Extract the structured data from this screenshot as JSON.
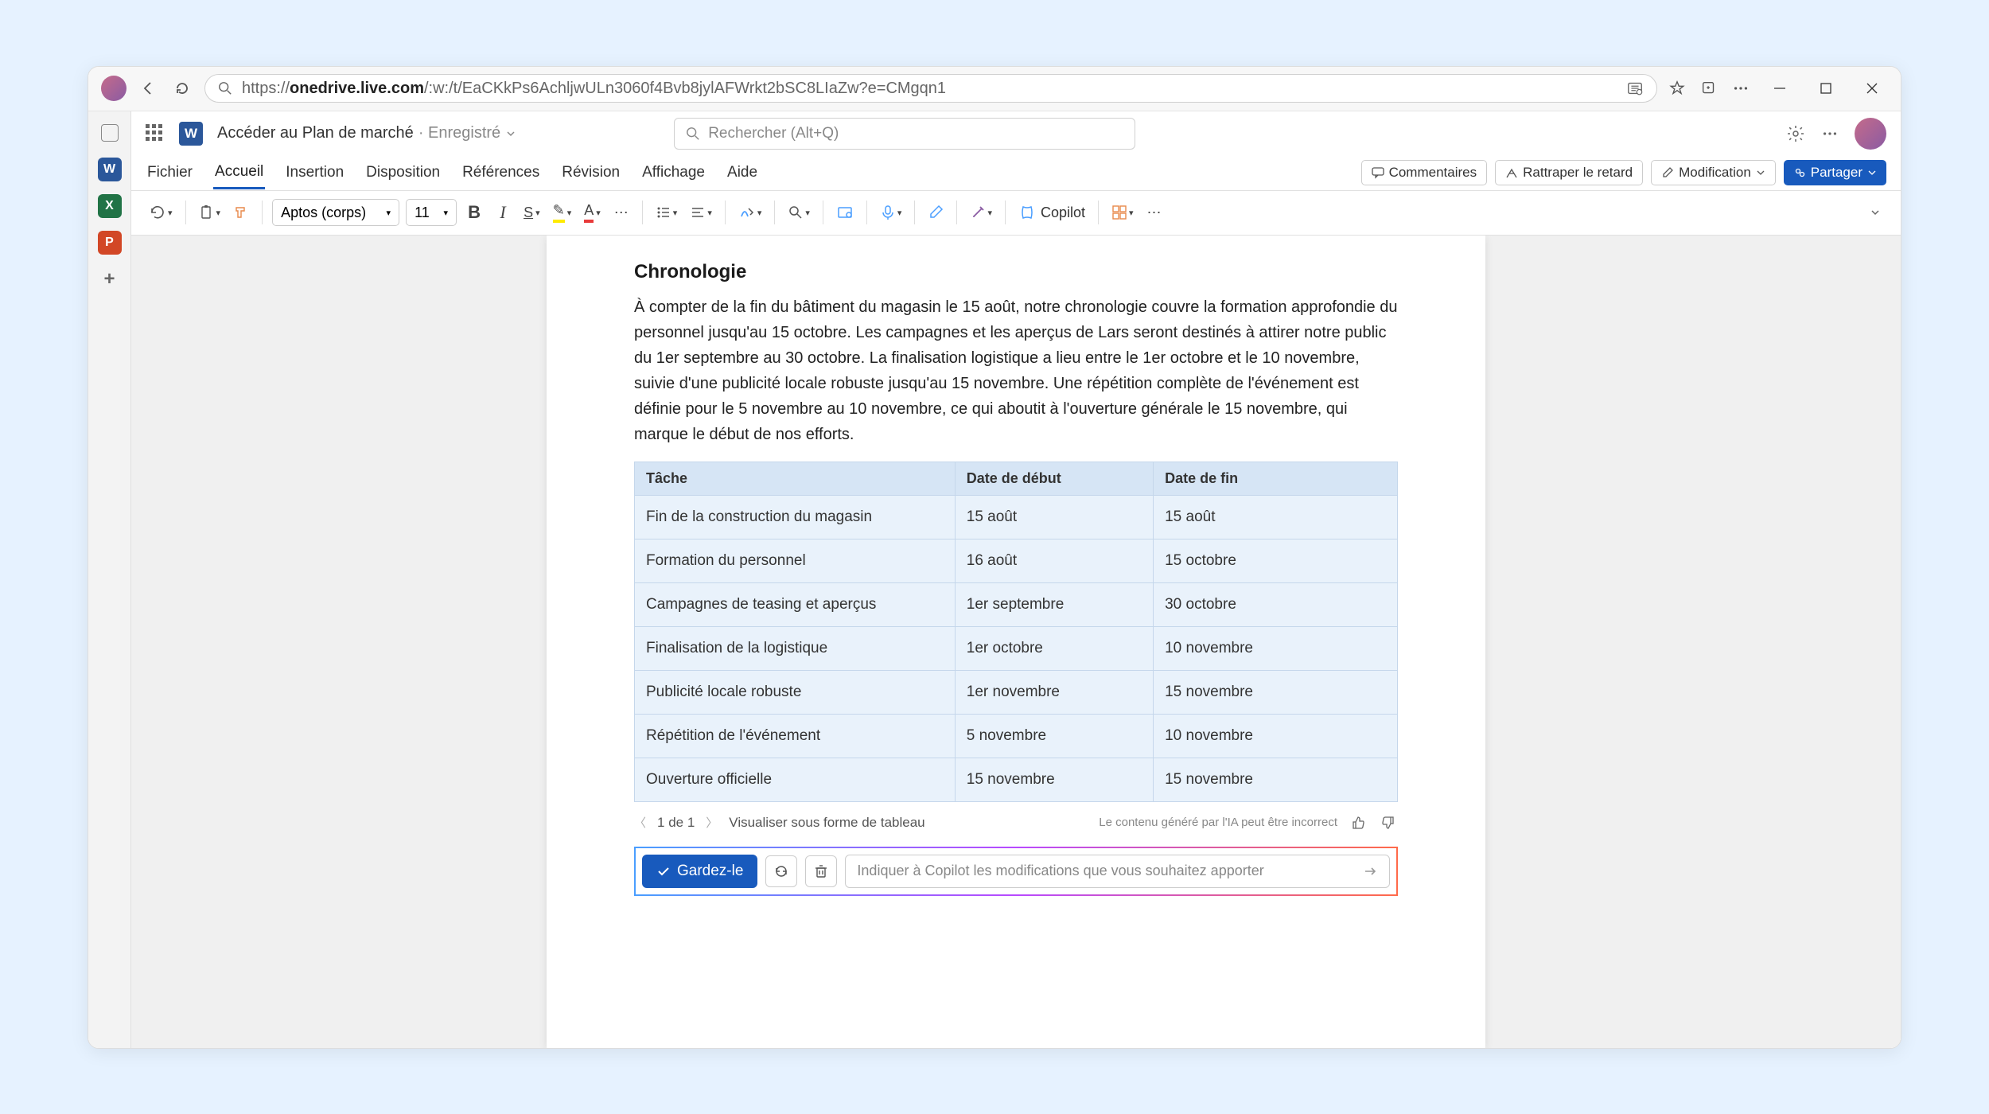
{
  "browser": {
    "url_prefix": "https://",
    "url_host": "onedrive.live.com",
    "url_path": "/:w:/t/EaCKkPs6AchljwULn3060f4Bvb8jylAFWrkt2bSC8LIaZw?e=CMgqn1"
  },
  "titlebar": {
    "doc_title": "Accéder au Plan de marché",
    "saved_status": "Enregistré",
    "search_placeholder": "Rechercher (Alt+Q)"
  },
  "menus": [
    "Fichier",
    "Accueil",
    "Insertion",
    "Disposition",
    "Références",
    "Révision",
    "Affichage",
    "Aide"
  ],
  "menu_active_index": 1,
  "menu_right": {
    "comments": "Commentaires",
    "catchup": "Rattraper le retard",
    "editing": "Modification",
    "share": "Partager"
  },
  "ribbon": {
    "font_name": "Aptos (corps)",
    "font_size": "11",
    "copilot": "Copilot"
  },
  "sidebar_apps": [
    "W",
    "X",
    "P"
  ],
  "document": {
    "heading": "Chronologie",
    "body": "À compter de la fin du bâtiment du magasin le 15 août, notre chronologie couvre la formation approfondie du personnel jusqu'au 15 octobre. Les campagnes et les aperçus de Lars seront destinés à attirer notre public du 1er septembre au 30 octobre. La finalisation logistique a lieu entre le 1er octobre et le 10 novembre, suivie d'une publicité locale robuste jusqu'au 15 novembre. Une répétition complète de l'événement est définie pour le 5 novembre au 10 novembre, ce qui aboutit à l'ouverture générale le 15 novembre, qui marque le début de nos efforts.",
    "table": {
      "headers": [
        "Tâche",
        "Date de début",
        "Date de fin"
      ],
      "rows": [
        [
          "Fin de la construction du magasin",
          "15 août",
          "15 août"
        ],
        [
          "Formation du personnel",
          "16 août",
          "15 octobre"
        ],
        [
          "Campagnes de teasing et aperçus",
          "1er septembre",
          "30 octobre"
        ],
        [
          "Finalisation de la logistique",
          "1er octobre",
          "10 novembre"
        ],
        [
          "Publicité locale robuste",
          "1er novembre",
          "15 novembre"
        ],
        [
          "Répétition de l'événement",
          "5 novembre",
          "10 novembre"
        ],
        [
          "Ouverture officielle",
          "15 novembre",
          "15 novembre"
        ]
      ]
    }
  },
  "pager": {
    "position": "1 de 1",
    "visualize": "Visualiser sous forme de tableau",
    "ai_note": "Le contenu généré par l'IA peut être incorrect"
  },
  "copilot_bar": {
    "keep": "Gardez-le",
    "input_placeholder": "Indiquer à Copilot les modifications que vous souhaitez apporter"
  }
}
